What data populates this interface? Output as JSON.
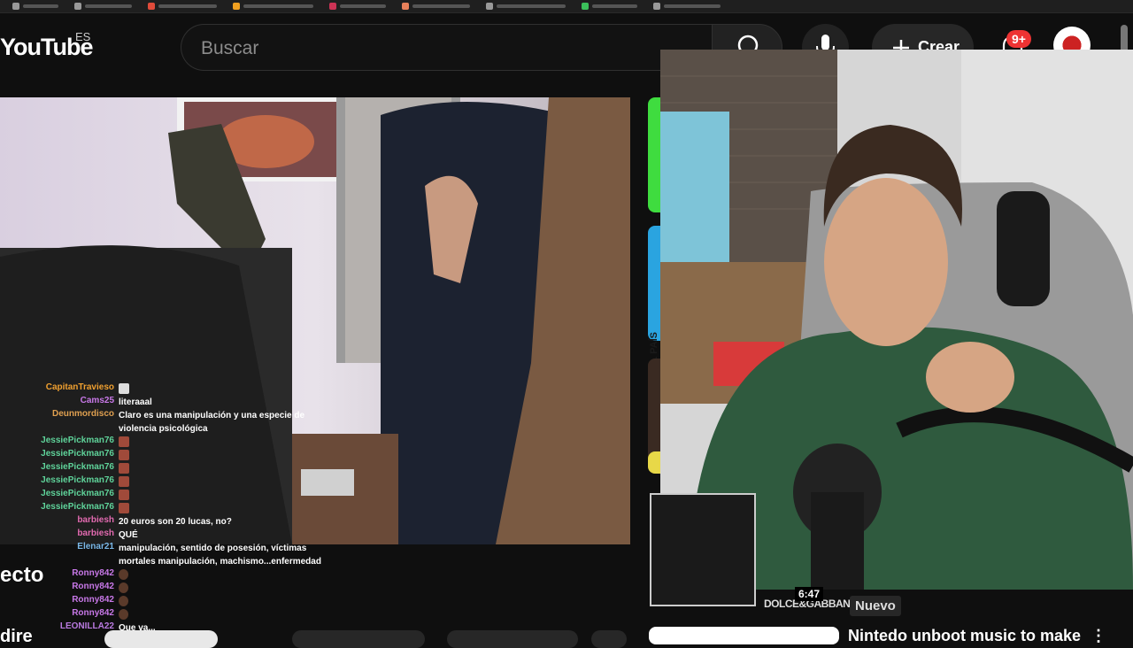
{
  "browser": {
    "bookmark_colors": [
      "#999999",
      "#999999",
      "#e04b3a",
      "#f0a020",
      "#cc3355",
      "#e8805a",
      "#999999",
      "#3bbf5a",
      "#999999"
    ]
  },
  "header": {
    "logo_text": "YouTube",
    "region": "ES",
    "search_placeholder": "Buscar",
    "create_label": "Crear",
    "notification_count": "9+"
  },
  "chat": {
    "messages": [
      {
        "user": "CapitanTravieso",
        "text": "",
        "color": "#f0a030",
        "emote": "hand"
      },
      {
        "user": "Cams25",
        "text": "literaaal",
        "color": "#c878e8"
      },
      {
        "user": "Deunmordisco",
        "text": "Claro es una manipulación y una especie de violencia psicológica",
        "color": "#e0a050"
      },
      {
        "user": "JessiePickman76",
        "text": "",
        "color": "#5fd39a",
        "emote": "img"
      },
      {
        "user": "JessiePickman76",
        "text": "",
        "color": "#5fd39a",
        "emote": "img"
      },
      {
        "user": "JessiePickman76",
        "text": "",
        "color": "#5fd39a",
        "emote": "img"
      },
      {
        "user": "JessiePickman76",
        "text": "",
        "color": "#5fd39a",
        "emote": "img"
      },
      {
        "user": "JessiePickman76",
        "text": "",
        "color": "#5fd39a",
        "emote": "img"
      },
      {
        "user": "JessiePickman76",
        "text": "",
        "color": "#5fd39a",
        "emote": "img"
      },
      {
        "user": "barbiesh",
        "text": "20 euros son 20 lucas, no?",
        "color": "#e26ab0"
      },
      {
        "user": "barbiesh",
        "text": "QUÉ",
        "color": "#e26ab0"
      },
      {
        "user": "Elenar21",
        "text": "manipulación, sentido de posesión, víctimas mortales manipulación, machismo...enfermedad",
        "color": "#7ab8e8"
      },
      {
        "user": "Ronny842",
        "text": "",
        "color": "#c878e8",
        "emote": "face"
      },
      {
        "user": "Ronny842",
        "text": "",
        "color": "#c878e8",
        "emote": "face"
      },
      {
        "user": "Ronny842",
        "text": "",
        "color": "#c878e8",
        "emote": "face"
      },
      {
        "user": "Ronny842",
        "text": "",
        "color": "#c878e8",
        "emote": "face"
      },
      {
        "user": "LEONILLA22",
        "text": "Que va...",
        "color": "#b97ae0"
      }
    ]
  },
  "video": {
    "title_fragment": "ecto",
    "title_fragment_2": "dire"
  },
  "sidebar": {
    "duration": "6:47",
    "brand_text": "DOLCE&GABBANA",
    "new_badge": "Nuevo",
    "next_title": "Nintedo unboot music to make",
    "strip_label": "EL PAÍS"
  }
}
